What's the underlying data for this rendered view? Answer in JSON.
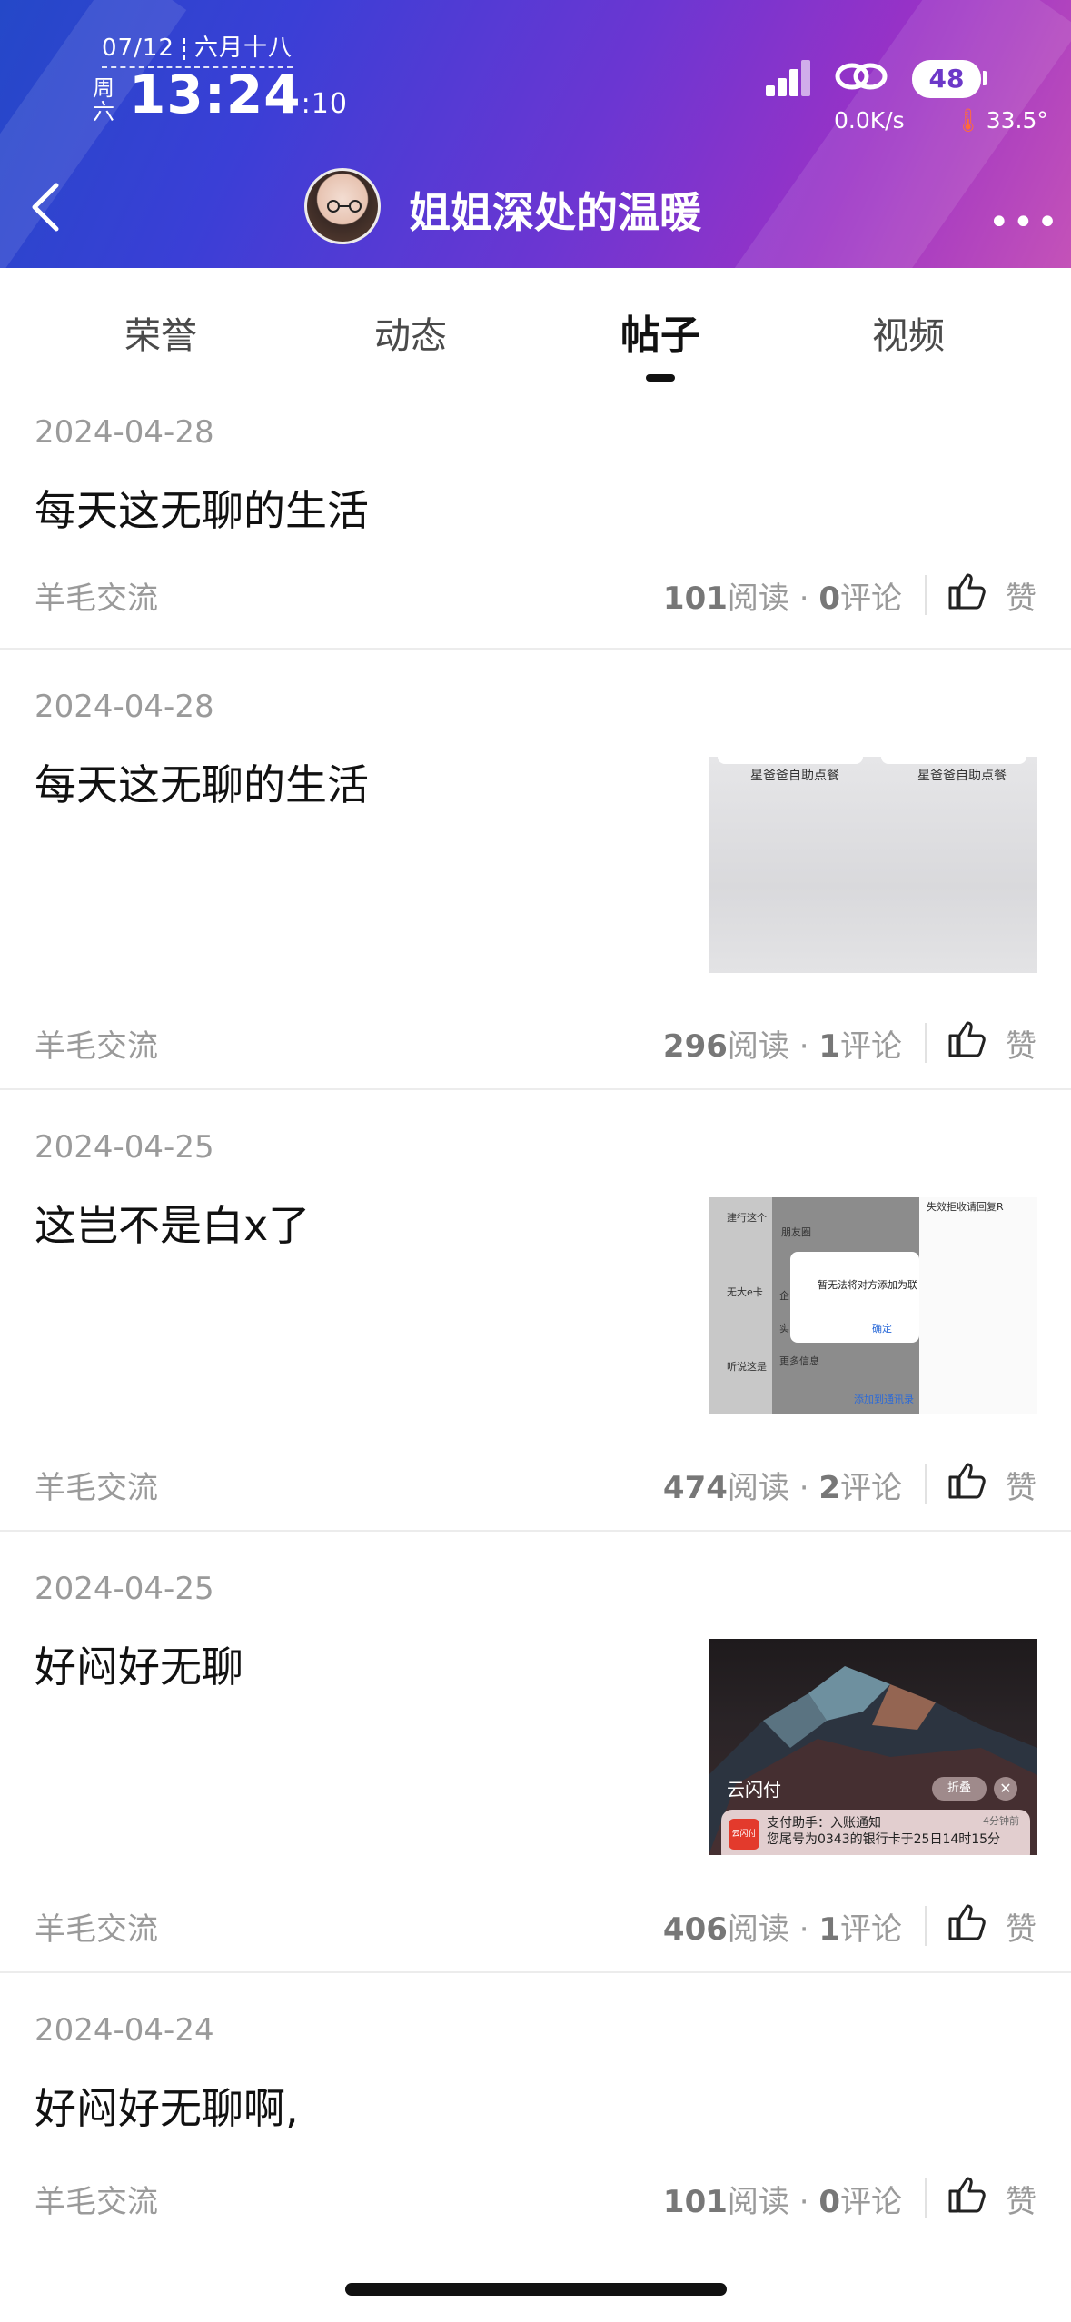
{
  "status_bar": {
    "date": "07/12",
    "lunar": "六月十八",
    "weekday": "周六",
    "time": "13:24",
    "seconds": ":10",
    "battery": "48",
    "net_speed": "0.0K/s",
    "temperature": "33.5°"
  },
  "header": {
    "title": "姐姐深处的温暖",
    "more": "•••"
  },
  "tabs": [
    {
      "label": "荣誉"
    },
    {
      "label": "动态"
    },
    {
      "label": "帖子",
      "active": true
    },
    {
      "label": "视频"
    }
  ],
  "posts": [
    {
      "date": "2024-04-28",
      "title": "每天这无聊的生活",
      "category": "羊毛交流",
      "reads": "101",
      "read_label": "阅读 · ",
      "comments": "0",
      "comment_label": "评论",
      "like_label": "赞"
    },
    {
      "date": "2024-04-28",
      "title": "每天这无聊的生活",
      "category": "羊毛交流",
      "reads": "296",
      "read_label": "阅读 · ",
      "comments": "1",
      "comment_label": "评论",
      "like_label": "赞",
      "thumb_text": [
        "星爸爸自助点餐",
        "星爸爸自助点餐"
      ]
    },
    {
      "date": "2024-04-25",
      "title": "这岂不是白x了",
      "category": "羊毛交流",
      "reads": "474",
      "read_label": "阅读 · ",
      "comments": "2",
      "comment_label": "评论",
      "like_label": "赞",
      "thumb_text": {
        "dialog": "暂无法将对方添加为联",
        "confirm": "确定",
        "top_right": "失效拒收请回复R",
        "lines": [
          "建行这个",
          "朋友圈",
          "无大e卡",
          "企",
          "实",
          "更多信息",
          "听说这是",
          "添加到通讯录"
        ]
      }
    },
    {
      "date": "2024-04-25",
      "title": "好闷好无聊",
      "category": "羊毛交流",
      "reads": "406",
      "read_label": "阅读 · ",
      "comments": "1",
      "comment_label": "评论",
      "like_label": "赞",
      "thumb_text": {
        "brand": "云闪付",
        "logo": "云闪付",
        "line1": "支付助手：入账通知",
        "line2": "您尾号为0343的银行卡于25日14时15分",
        "time": "4分钟前",
        "fold": "折叠",
        "close": "✕"
      }
    },
    {
      "date": "2024-04-24",
      "title": "好闷好无聊啊,",
      "category": "羊毛交流",
      "reads": "101",
      "read_label": "阅读 · ",
      "comments": "0",
      "comment_label": "评论",
      "like_label": "赞"
    }
  ]
}
